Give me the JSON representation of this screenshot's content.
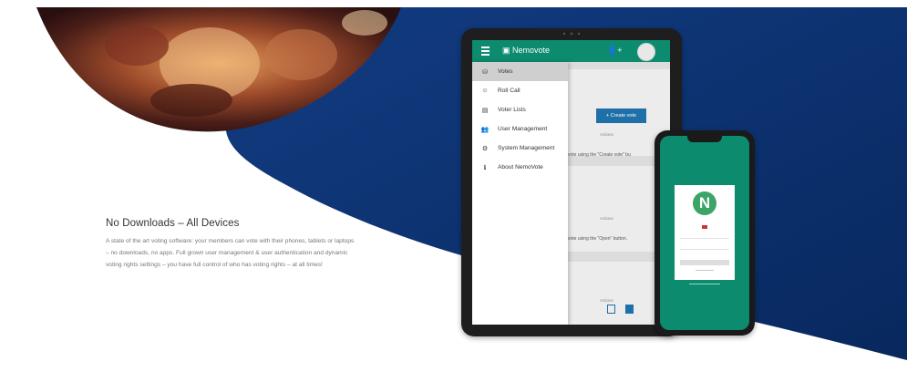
{
  "section": {
    "heading": "No Downloads – All Devices",
    "body": "A state of the art voting software: your members can vote with their phones, tablets or laptops – no downloads, no apps. Full grown user management & user authentication and dynamic voting rights settings – you have full control of who has voting rights – at all times!"
  },
  "tablet": {
    "app_name": "Nemovote",
    "menu": [
      {
        "label": "Votes",
        "icon": "ballot-icon",
        "glyph": "⛁",
        "selected": true
      },
      {
        "label": "Roll Call",
        "icon": "roll-call-icon",
        "glyph": "☺",
        "selected": false
      },
      {
        "label": "Voter Lists",
        "icon": "list-icon",
        "glyph": "▤",
        "selected": false
      },
      {
        "label": "User Management",
        "icon": "users-icon",
        "glyph": "👥",
        "selected": false
      },
      {
        "label": "System Management",
        "icon": "gear-icon",
        "glyph": "⚙",
        "selected": false
      },
      {
        "label": "About NemoVote",
        "icon": "info-icon",
        "glyph": "ℹ",
        "selected": false
      }
    ],
    "background": {
      "create_button": "+ Create vote",
      "hint1": "vote using the \"Create vote\" bu",
      "hint2": "vote using the \"Open\" button.",
      "actions": "Actions"
    }
  },
  "colors": {
    "navy": "#0b2f6e",
    "brand_green": "#0c8b6e",
    "accent_blue": "#1f6fa8"
  }
}
